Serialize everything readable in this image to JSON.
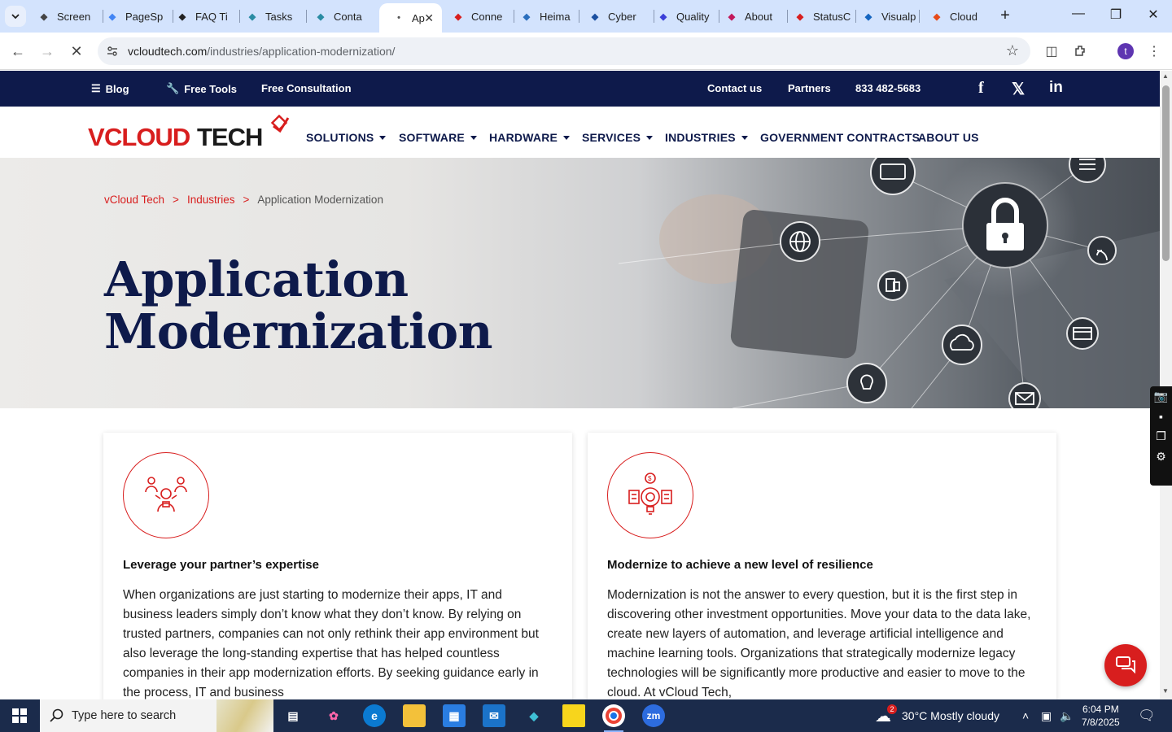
{
  "browser": {
    "tabs": [
      {
        "label": "Screen",
        "icon": "screencast-icon",
        "color": "#444"
      },
      {
        "label": "PageSp",
        "icon": "pagespeed-icon",
        "color": "#4285f4"
      },
      {
        "label": "FAQ Ti",
        "icon": "faq-icon",
        "color": "#222"
      },
      {
        "label": "Tasks",
        "icon": "tasks-icon",
        "color": "#2a8ca3"
      },
      {
        "label": "Conta",
        "icon": "contact-icon",
        "color": "#2a8ca3"
      },
      {
        "label": "Ap",
        "icon": "loading-icon",
        "color": "#555"
      },
      {
        "label": "Conne",
        "icon": "vcloud-icon",
        "color": "#d81e1e"
      },
      {
        "label": "Heima",
        "icon": "heimdal-icon",
        "color": "#2a6ebd"
      },
      {
        "label": "Cyber",
        "icon": "cyber-icon",
        "color": "#1a4fa0"
      },
      {
        "label": "Quality",
        "icon": "quality-icon",
        "color": "#3b3fd8"
      },
      {
        "label": "About",
        "icon": "about-icon",
        "color": "#c2185b"
      },
      {
        "label": "StatusC",
        "icon": "status-icon",
        "color": "#d81e1e"
      },
      {
        "label": "Visualp",
        "icon": "visualping-icon",
        "color": "#1565c0"
      },
      {
        "label": "Cloud",
        "icon": "cloud-icon",
        "color": "#e64a19"
      }
    ],
    "url_host": "vcloudtech.com",
    "url_path": "/industries/application-modernization/",
    "avatar_letter": "t"
  },
  "topbar": {
    "blog": "Blog",
    "free_tools": "Free Tools",
    "free_consultation": "Free Consultation",
    "contact": "Contact us",
    "partners": "Partners",
    "phone": "833 482-5683"
  },
  "nav": {
    "logo_text": "VCLOUD TECH",
    "items": [
      "SOLUTIONS",
      "SOFTWARE",
      "HARDWARE",
      "SERVICES",
      "INDUSTRIES",
      "GOVERNMENT CONTRACTS",
      "ABOUT US"
    ]
  },
  "hero": {
    "breadcrumb": [
      "vCloud Tech",
      "Industries",
      "Application Modernization"
    ],
    "separator": ">",
    "title_line1": "Application",
    "title_line2": "Modernization"
  },
  "cards": [
    {
      "title": "Leverage your partner’s expertise",
      "body": "When organizations are just starting to modernize their apps, IT and business leaders simply don’t know what they don’t know. By relying on trusted partners, companies can not only rethink their app environment but also leverage the long-standing expertise that has helped countless companies in their app modernization efforts. By seeking guidance early in the process, IT and business"
    },
    {
      "title": "Modernize to achieve a new level of resilience",
      "body": "Modernization is not the answer to every question, but it is the first step in discovering other investment opportunities. Move your data to the data lake, create new layers of automation, and leverage artificial intelligence and machine learning tools. Organizations that strategically modernize legacy technologies will be significantly more productive and easier to move to the cloud. At vCloud Tech,"
    }
  ],
  "taskbar": {
    "search_placeholder": "Type here to search",
    "weather": "30°C  Mostly cloudy",
    "weather_badge": "2",
    "time": "6:04 PM",
    "date": "7/8/2025"
  },
  "colors": {
    "navy": "#0e1a4b",
    "accent_red": "#d81e1e"
  }
}
